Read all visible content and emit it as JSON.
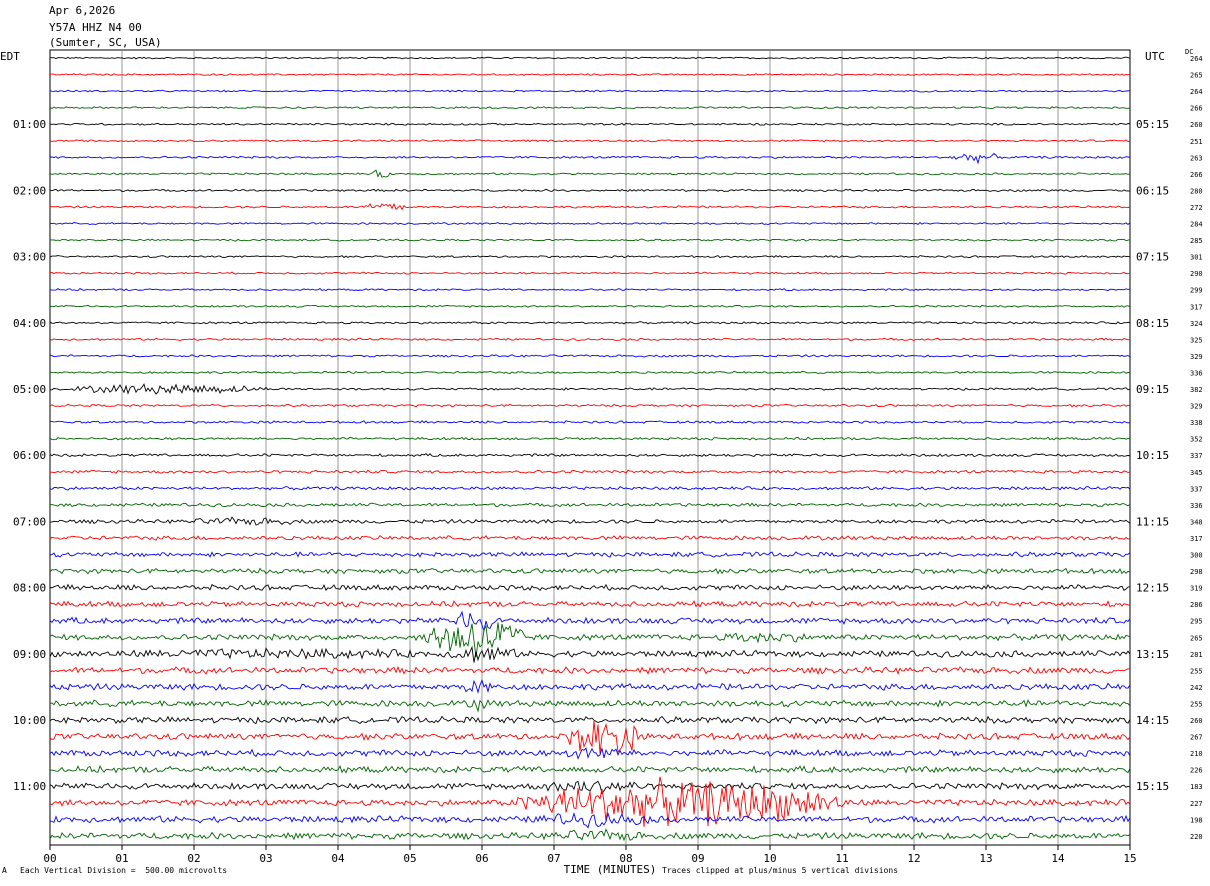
{
  "header": {
    "date": "Apr 6,2026",
    "station": "Y57A HHZ N4 00",
    "location": "(Sumter, SC, USA)"
  },
  "left_timezone": "EDT",
  "right_timezone": "UTC",
  "dc_label": "DC",
  "footer": {
    "scale_note": "Each Vertical Division =  500.00 microvolts",
    "clip_note": "Traces clipped at plus/minus 5 vertical divisions",
    "corner_mark": "A"
  },
  "colors": {
    "cycle": [
      "#000000",
      "#ff0000",
      "#0000ff",
      "#006400"
    ],
    "grid": "#808080"
  },
  "chart_data": {
    "type": "line",
    "subtype": "helicorder",
    "xlabel": "TIME (MINUTES)",
    "x_ticks": [
      "00",
      "01",
      "02",
      "03",
      "04",
      "05",
      "06",
      "07",
      "08",
      "09",
      "10",
      "11",
      "12",
      "13",
      "14",
      "15"
    ],
    "xlim": [
      0,
      15
    ],
    "trace_minutes": 15,
    "left_hour_labels": [
      "01:00",
      "02:00",
      "03:00",
      "04:00",
      "05:00",
      "06:00",
      "07:00",
      "08:00",
      "09:00",
      "10:00",
      "11:00"
    ],
    "right_hour_labels": [
      "05:15",
      "06:15",
      "07:15",
      "08:15",
      "09:15",
      "10:15",
      "11:15",
      "12:15",
      "13:15",
      "14:15",
      "15:15"
    ],
    "dc_offsets": [
      264,
      265,
      264,
      266,
      260,
      251,
      263,
      266,
      280,
      272,
      284,
      285,
      301,
      290,
      299,
      317,
      324,
      325,
      329,
      336,
      382,
      329,
      338,
      352,
      337,
      345,
      337,
      336,
      348,
      317,
      300,
      298,
      319,
      286,
      295,
      265,
      281,
      255,
      242,
      255,
      260,
      267,
      210,
      226,
      183,
      227,
      198,
      220
    ],
    "trace_amplitude": [
      0.8,
      0.8,
      0.8,
      0.9,
      0.9,
      0.9,
      1.0,
      0.9,
      1.0,
      1.0,
      0.9,
      0.9,
      0.9,
      0.9,
      0.9,
      0.9,
      1.0,
      1.0,
      1.0,
      1.0,
      1.1,
      1.1,
      1.1,
      1.2,
      1.3,
      1.4,
      1.5,
      1.6,
      1.8,
      2.0,
      2.2,
      2.3,
      2.5,
      2.6,
      2.8,
      2.8,
      3.0,
      3.0,
      3.0,
      3.0,
      3.0,
      3.0,
      3.0,
      3.0,
      3.0,
      3.0,
      3.0,
      3.0
    ],
    "events": [
      {
        "trace": 20,
        "start_min": 0.2,
        "end_min": 3.0,
        "amplitude": 5
      },
      {
        "trace": 9,
        "start_min": 4.3,
        "end_min": 5.0,
        "amplitude": 5
      },
      {
        "trace": 7,
        "start_min": 4.5,
        "end_min": 4.7,
        "amplitude": 6
      },
      {
        "trace": 6,
        "start_min": 12.5,
        "end_min": 13.2,
        "amplitude": 5
      },
      {
        "trace": 35,
        "start_min": 5.2,
        "end_min": 6.6,
        "amplitude": 22
      },
      {
        "trace": 34,
        "start_min": 5.6,
        "end_min": 6.2,
        "amplitude": 12
      },
      {
        "trace": 36,
        "start_min": 5.5,
        "end_min": 6.5,
        "amplitude": 9
      },
      {
        "trace": 38,
        "start_min": 5.7,
        "end_min": 6.2,
        "amplitude": 8
      },
      {
        "trace": 39,
        "start_min": 5.8,
        "end_min": 6.1,
        "amplitude": 8
      },
      {
        "trace": 35,
        "start_min": 9.2,
        "end_min": 10.6,
        "amplitude": 6
      },
      {
        "trace": 45,
        "start_min": 6.5,
        "end_min": 11.0,
        "amplitude": 22
      },
      {
        "trace": 41,
        "start_min": 7.2,
        "end_min": 8.2,
        "amplitude": 20
      },
      {
        "trace": 42,
        "start_min": 7.1,
        "end_min": 8.0,
        "amplitude": 8
      },
      {
        "trace": 44,
        "start_min": 6.8,
        "end_min": 8.3,
        "amplitude": 8
      },
      {
        "trace": 46,
        "start_min": 6.6,
        "end_min": 8.5,
        "amplitude": 7
      },
      {
        "trace": 47,
        "start_min": 6.8,
        "end_min": 8.4,
        "amplitude": 6
      },
      {
        "trace": 36,
        "start_min": 0.3,
        "end_min": 6.0,
        "amplitude": 5
      },
      {
        "trace": 28,
        "start_min": 1.8,
        "end_min": 3.6,
        "amplitude": 4
      }
    ],
    "grid": true
  }
}
